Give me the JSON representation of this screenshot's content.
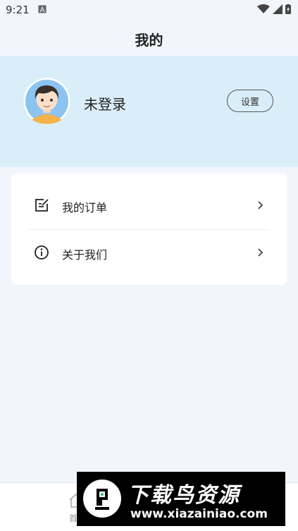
{
  "status": {
    "time": "9:21"
  },
  "header": {
    "title": "我的"
  },
  "profile": {
    "username": "未登录",
    "settings_label": "设置"
  },
  "menu": {
    "items": [
      {
        "label": "我的订单",
        "icon": "order-edit-icon"
      },
      {
        "label": "关于我们",
        "icon": "info-icon"
      }
    ]
  },
  "tabbar": {
    "home_label": "首"
  },
  "watermark": {
    "title": "下载鸟资源",
    "url": "www.xiazainiao.com"
  }
}
